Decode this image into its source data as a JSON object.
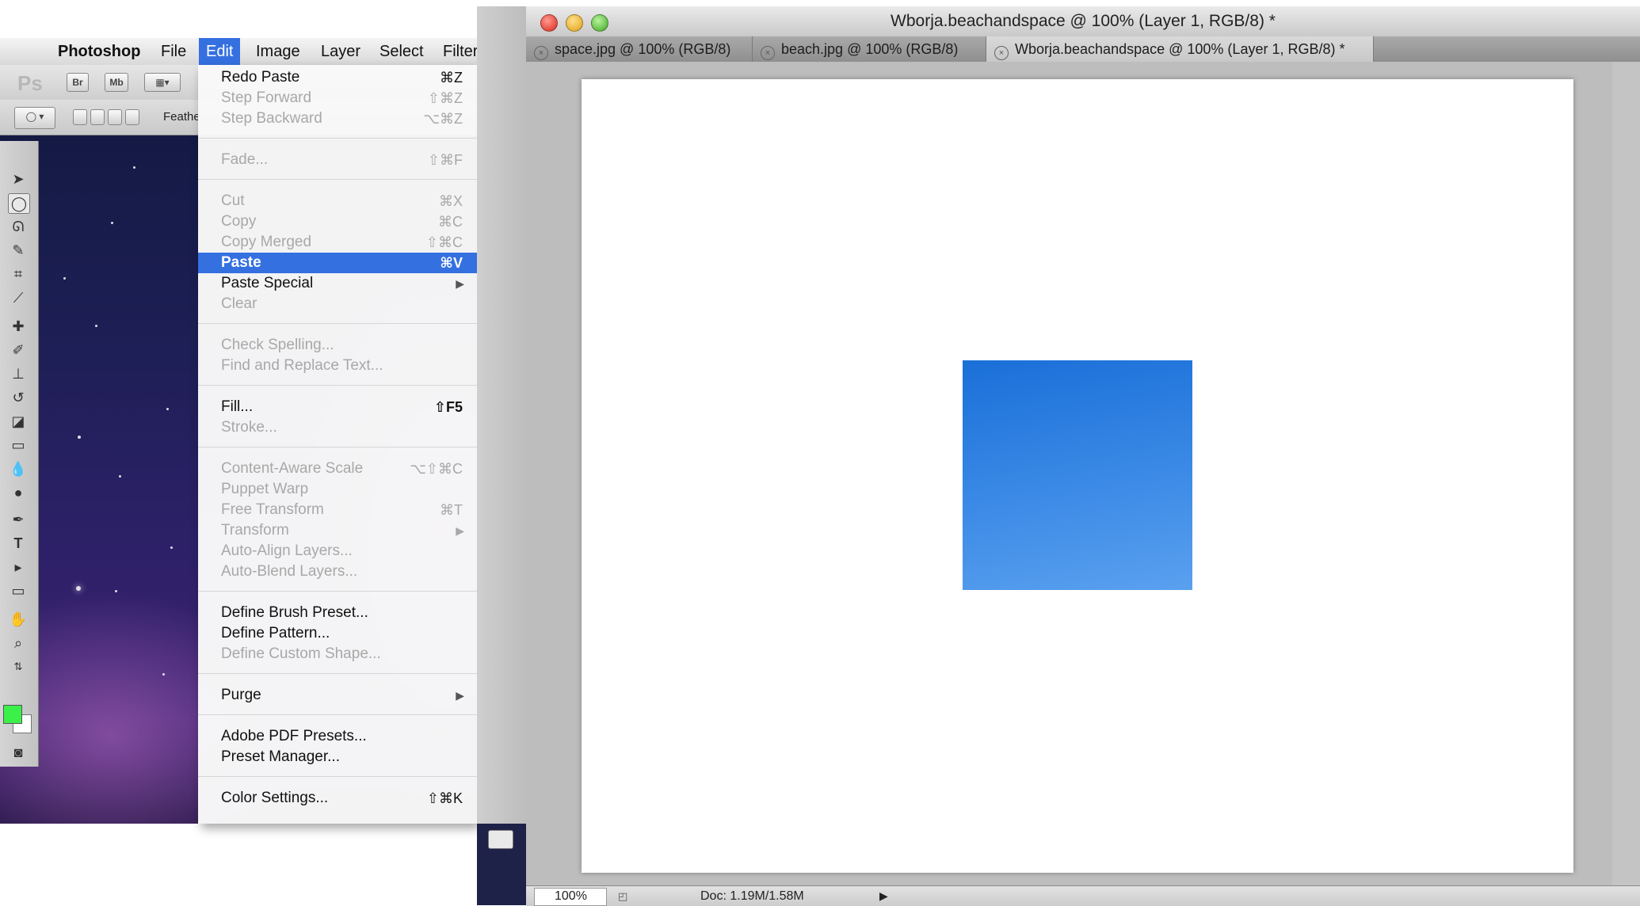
{
  "menubar": {
    "items": [
      {
        "label": "Photoshop",
        "bold": true
      },
      {
        "label": "File"
      },
      {
        "label": "Edit",
        "active": true
      },
      {
        "label": "Image"
      },
      {
        "label": "Layer"
      },
      {
        "label": "Select"
      },
      {
        "label": "Filter"
      }
    ]
  },
  "options_bar": {
    "ps_logo": "Ps",
    "bridge_label": "Br",
    "minibridge_label": "Mb",
    "feather_label": "Feathe"
  },
  "edit_menu": {
    "items": [
      {
        "label": "Redo Paste",
        "shortcut": "⌘Z",
        "enabled": true
      },
      {
        "label": "Step Forward",
        "shortcut": "⇧⌘Z",
        "enabled": false
      },
      {
        "label": "Step Backward",
        "shortcut": "⌥⌘Z",
        "enabled": false
      },
      {
        "label": "Fade...",
        "shortcut": "⇧⌘F",
        "enabled": false
      },
      {
        "label": "Cut",
        "shortcut": "⌘X",
        "enabled": false
      },
      {
        "label": "Copy",
        "shortcut": "⌘C",
        "enabled": false
      },
      {
        "label": "Copy Merged",
        "shortcut": "⇧⌘C",
        "enabled": false
      },
      {
        "label": "Paste",
        "shortcut": "⌘V",
        "enabled": true,
        "selected": true
      },
      {
        "label": "Paste Special",
        "shortcut": "",
        "enabled": true,
        "submenu": true
      },
      {
        "label": "Clear",
        "shortcut": "",
        "enabled": false
      },
      {
        "label": "Check Spelling...",
        "shortcut": "",
        "enabled": false
      },
      {
        "label": "Find and Replace Text...",
        "shortcut": "",
        "enabled": false
      },
      {
        "label": "Fill...",
        "shortcut": "⇧F5",
        "enabled": true
      },
      {
        "label": "Stroke...",
        "shortcut": "",
        "enabled": false
      },
      {
        "label": "Content-Aware Scale",
        "shortcut": "⌥⇧⌘C",
        "enabled": false
      },
      {
        "label": "Puppet Warp",
        "shortcut": "",
        "enabled": false
      },
      {
        "label": "Free Transform",
        "shortcut": "⌘T",
        "enabled": false
      },
      {
        "label": "Transform",
        "shortcut": "",
        "enabled": false,
        "submenu": true
      },
      {
        "label": "Auto-Align Layers...",
        "shortcut": "",
        "enabled": false
      },
      {
        "label": "Auto-Blend Layers...",
        "shortcut": "",
        "enabled": false
      },
      {
        "label": "Define Brush Preset...",
        "shortcut": "",
        "enabled": true
      },
      {
        "label": "Define Pattern...",
        "shortcut": "",
        "enabled": true
      },
      {
        "label": "Define Custom Shape...",
        "shortcut": "",
        "enabled": false
      },
      {
        "label": "Purge",
        "shortcut": "",
        "enabled": true,
        "submenu": true
      },
      {
        "label": "Adobe PDF Presets...",
        "shortcut": "",
        "enabled": true
      },
      {
        "label": "Preset Manager...",
        "shortcut": "",
        "enabled": true
      },
      {
        "label": "Color Settings...",
        "shortcut": "⇧⌘K",
        "enabled": true
      }
    ]
  },
  "document": {
    "title": "Wborja.beachandspace @ 100% (Layer 1, RGB/8) *",
    "tabs": [
      {
        "label": "space.jpg @ 100% (RGB/8)",
        "active": false
      },
      {
        "label": "beach.jpg @ 100% (RGB/8)",
        "active": false
      },
      {
        "label": "Wborja.beachandspace @ 100% (Layer 1, RGB/8) *",
        "active": true
      }
    ],
    "zoom": "100%",
    "doc_info": "Doc: 1.19M/1.58M",
    "square_color": "#2f80e2"
  },
  "colors": {
    "accent": "#3470e0",
    "foreground_swatch": "#3cf04a",
    "background_swatch": "#ffffff"
  }
}
